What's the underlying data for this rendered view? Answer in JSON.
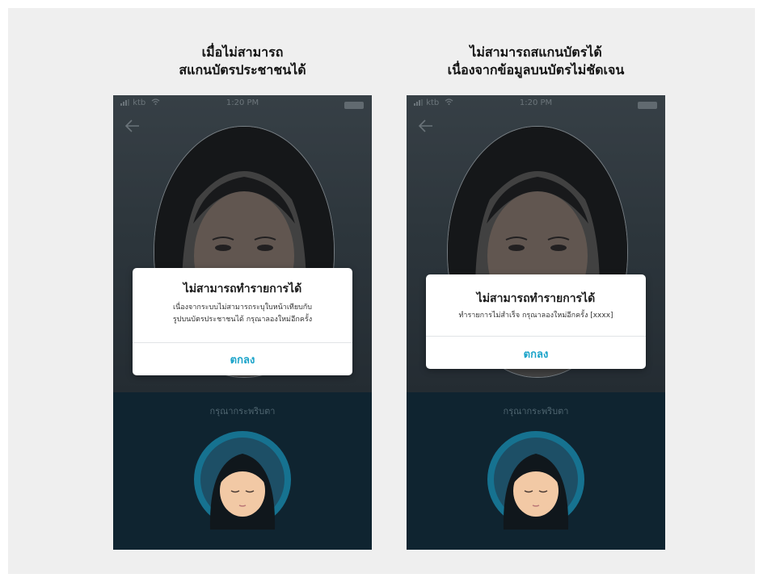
{
  "panels": [
    {
      "caption_line1": "เมื่อไม่สามารถ",
      "caption_line2": "สแกนบัตรประชาชนได้",
      "status": {
        "carrier": "ktb",
        "time": "1:20 PM"
      },
      "instruction": "กรุณากระพริบตา",
      "dialog": {
        "title": "ไม่สามารถทำรายการได้",
        "message_line1": "เนื่องจากระบบไม่สามารถระบุใบหน้าเทียบกับ",
        "message_line2": "รูปบนบัตรประชาชนได้ กรุณาลองใหม่อีกครั้ง",
        "button": "ตกลง"
      }
    },
    {
      "caption_line1": "ไม่สามารถสแกนบัตรได้",
      "caption_line2": "เนื่องจากข้อมูลบนบัตรไม่ชัดเจน",
      "status": {
        "carrier": "ktb",
        "time": "1:20 PM"
      },
      "instruction": "กรุณากระพริบตา",
      "dialog": {
        "title": "ไม่สามารถทำรายการได้",
        "message_line1": "ทำรายการไม่สำเร็จ กรุณาลองใหม่อีกครั้ง [xxxx]",
        "button": "ตกลง"
      }
    }
  ],
  "colors": {
    "background": "#efefef",
    "accent": "#1aa3c9",
    "screen_bottom": "#0f2430"
  },
  "icons": [
    "signal-icon",
    "wifi-icon",
    "battery-icon",
    "back-arrow-icon",
    "face-avatar-icon"
  ]
}
